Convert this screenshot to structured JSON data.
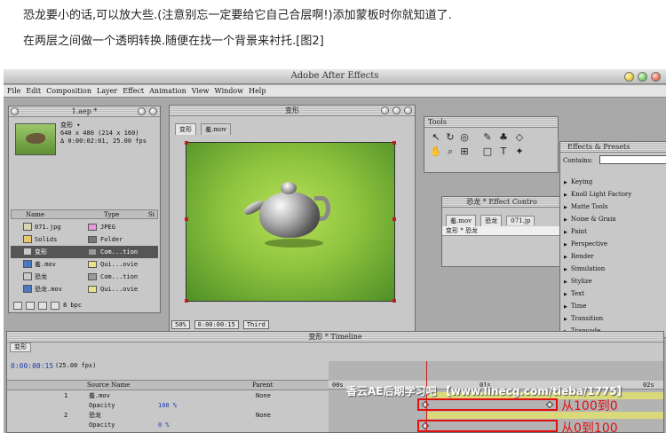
{
  "post": {
    "line1": "恐龙要小的话,可以放大些.(注意别忘一定要给它自己合层啊!)添加蒙板时你就知道了.",
    "line2": "在两层之间做一个透明转换.随便在找一个背景来衬托.[图2]"
  },
  "app": {
    "title": "Adobe After Effects",
    "menu": [
      "File",
      "Edit",
      "Composition",
      "Layer",
      "Effect",
      "Animation",
      "View",
      "Window",
      "Help"
    ]
  },
  "project": {
    "title": "1.aep *",
    "info": [
      "变形 ▾",
      "640 x 480  (214 x 160)",
      "Δ 0:00:02:01, 25.00 fps"
    ],
    "columns": {
      "name": "Name",
      "type": "Type",
      "size": "Si"
    },
    "items": [
      {
        "name": "071.jpg",
        "type": "JPEG",
        "color": "#e49ad8"
      },
      {
        "name": "Solids",
        "type": "Folder",
        "color": "#777777"
      },
      {
        "name": "变形",
        "type": "Com...tion",
        "color": "#9a9a9a"
      },
      {
        "name": "羞.mov",
        "type": "Qui...ovie",
        "color": "#e6e38a"
      },
      {
        "name": "恐龙",
        "type": "Com...tion",
        "color": "#9a9a9a"
      },
      {
        "name": "恐龙.mov",
        "type": "Qui...ovie",
        "color": "#e6e38a"
      }
    ],
    "footer_bpc": "8 bpc"
  },
  "comp": {
    "title": "变形",
    "tabs": [
      "变形",
      "羞.mov"
    ],
    "zoom": "50%",
    "timecode": "0:00:00:15",
    "resolution": "Third"
  },
  "tools": {
    "title": "Tools"
  },
  "effect_controls": {
    "title": "恐龙 * Effect Contro",
    "tabs": [
      "羞.mov",
      "恐龙",
      "071.jp"
    ],
    "row": "变形 * 恐龙"
  },
  "presets": {
    "title": "Effects & Presets",
    "contains_label": "Contains:",
    "items": [
      "Keying",
      "Knoll Light Factory",
      "Matte Tools",
      "Noise & Grain",
      "Paint",
      "Perspective",
      "Render",
      "Simulation",
      "Stylize",
      "Text",
      "Time",
      "Transition",
      "Trapcode"
    ]
  },
  "timeline": {
    "title": "变形 * Timeline",
    "tab": "变形",
    "time": "0:00:00:15",
    "fps": "(25.00 fps)",
    "columns": {
      "source": "Source Name",
      "parent": "Parent"
    },
    "layers": [
      {
        "num": "1",
        "name": "羞.mov",
        "parent": "None"
      },
      {
        "prop": "Opacity",
        "value": "100 %"
      },
      {
        "num": "2",
        "name": "恐龙",
        "parent": "None"
      },
      {
        "prop": "Opacity",
        "value": "0 %"
      }
    ],
    "ruler": {
      "start": "00s",
      "mid": "01s",
      "end": "02s"
    }
  },
  "annotations": {
    "a1": "从100到0",
    "a2": "从0到100"
  },
  "watermark": "香云AE后期学习吧 【www.linecg.com/tieba/1775】",
  "colors": {
    "accent_red": "#e0100f",
    "timecode_blue": "#1d3bb0"
  }
}
